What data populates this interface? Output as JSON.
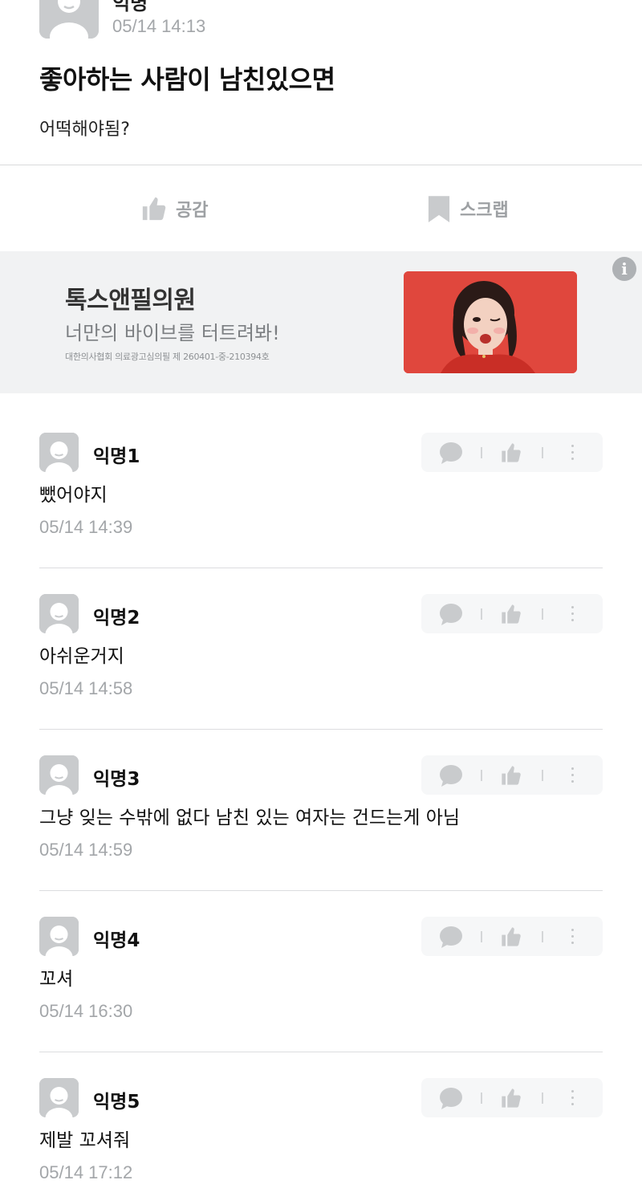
{
  "post": {
    "author": "익명",
    "time": "05/14 14:13",
    "title": "좋아하는 사람이 남친있으면",
    "body": "어떡해야됨?"
  },
  "actions": {
    "like_label": "공감",
    "like_icon": "thumbs-up-icon",
    "scrap_label": "스크랩",
    "scrap_icon": "bookmark-icon"
  },
  "ad": {
    "title": "톡스앤필의원",
    "subtitle": "너만의 바이브를 터트려봐!",
    "legal": "대한의사협회 의료광고심의필 제 260401-중-210394호",
    "info_icon": "info-icon",
    "info_glyph": "i",
    "image_background": "#e0473d"
  },
  "comments": [
    {
      "author": "익명1",
      "text": "뺐어야지",
      "time": "05/14 14:39"
    },
    {
      "author": "익명2",
      "text": "아쉬운거지",
      "time": "05/14 14:58"
    },
    {
      "author": "익명3",
      "text": "그냥 잊는 수밖에 없다 남친 있는 여자는 건드는게 아님",
      "time": "05/14 14:59"
    },
    {
      "author": "익명4",
      "text": "꼬셔",
      "time": "05/14 16:30"
    },
    {
      "author": "익명5",
      "text": "제발 꼬셔줘",
      "time": "05/14 17:12"
    }
  ],
  "comment_tools": {
    "reply_icon": "speech-bubble-icon",
    "like_icon": "thumbs-up-icon",
    "more_icon": "more-vertical-icon"
  },
  "colors": {
    "meta_gray": "#a3a6a9",
    "avatar_gray": "#c9cbcd",
    "ad_background": "#f1f2f3",
    "icon_gray": "#c9cbcd"
  }
}
